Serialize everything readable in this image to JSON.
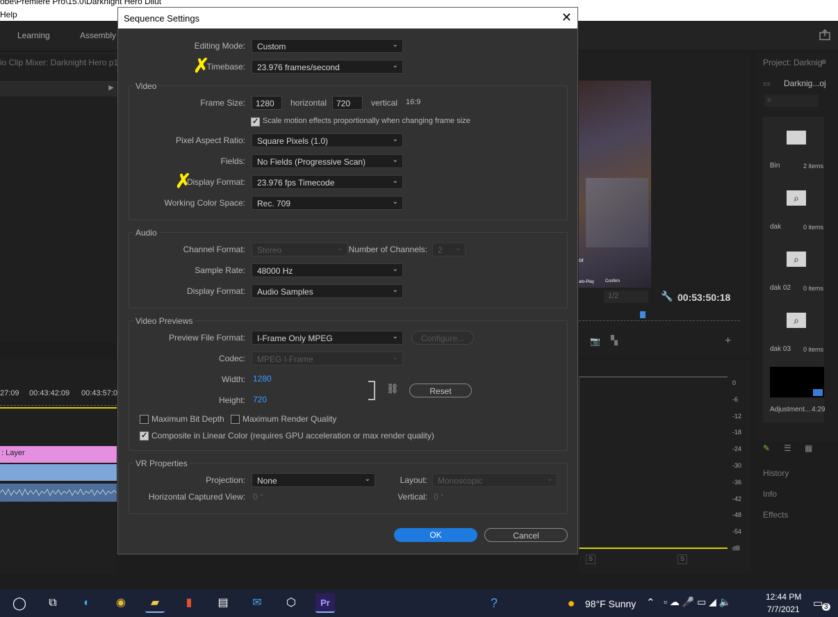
{
  "window": {
    "path_title": "obe\\Premiere Pro\\15.0\\Darknight Hero Dilut",
    "menu_help": "Help"
  },
  "workspace": {
    "tabs": [
      "Learning",
      "Assembly"
    ]
  },
  "left_panel": {
    "mixer_title": "io Clip Mixer: Darknight Hero p1",
    "timecodes": [
      "27:09",
      "00:43:42:09",
      "00:43:57:0"
    ],
    "clip_label": ": Layer"
  },
  "program": {
    "zoom": "1/2",
    "timecode": "00:53:50:18",
    "game_prompt": "Confirm",
    "game_side": "ato-Play",
    "game_or": "or"
  },
  "project": {
    "title": "Project: Darknig",
    "file": "Darknig...oj",
    "items": [
      {
        "name": "Bin",
        "count": "2 items"
      },
      {
        "name": "dak",
        "count": "0 items"
      },
      {
        "name": "dak 02",
        "count": "0 items"
      },
      {
        "name": "dak 03",
        "count": "0 items"
      },
      {
        "name": "Adjustment...",
        "count": "4:29"
      }
    ],
    "panels": [
      "History",
      "Info",
      "Effects"
    ]
  },
  "meter": {
    "labels": [
      "0",
      "-6",
      "-12",
      "-18",
      "-24",
      "-30",
      "-36",
      "-42",
      "-48",
      "-54",
      "dB"
    ],
    "solo": [
      "S",
      "S"
    ]
  },
  "dialog": {
    "title": "Sequence Settings",
    "editing_mode": {
      "label": "Editing Mode:",
      "value": "Custom"
    },
    "timebase": {
      "label": "Timebase:",
      "value": "23.976  frames/second"
    },
    "video": {
      "title": "Video",
      "frame_size_label": "Frame Size:",
      "width": "1280",
      "horizontal": "horizontal",
      "height": "720",
      "vertical": "vertical",
      "ratio": "16:9",
      "scale_label": "Scale motion effects proportionally when changing frame size",
      "par_label": "Pixel Aspect Ratio:",
      "par_value": "Square Pixels (1.0)",
      "fields_label": "Fields:",
      "fields_value": "No Fields (Progressive Scan)",
      "display_label": "Display Format:",
      "display_value": "23.976 fps Timecode",
      "color_label": "Working Color Space:",
      "color_value": "Rec. 709"
    },
    "audio": {
      "title": "Audio",
      "channel_label": "Channel Format:",
      "channel_value": "Stereo",
      "num_label": "Number of Channels:",
      "num_value": "2",
      "rate_label": "Sample Rate:",
      "rate_value": "48000 Hz",
      "display_label": "Display Format:",
      "display_value": "Audio Samples"
    },
    "previews": {
      "title": "Video Previews",
      "format_label": "Preview File Format:",
      "format_value": "I-Frame Only MPEG",
      "configure": "Configure...",
      "codec_label": "Codec:",
      "codec_value": "MPEG I-Frame",
      "width_label": "Width:",
      "width_value": "1280",
      "height_label": "Height:",
      "height_value": "720",
      "reset": "Reset",
      "max_depth": "Maximum Bit Depth",
      "max_quality": "Maximum Render Quality",
      "composite": "Composite in Linear Color (requires GPU acceleration or max render quality)"
    },
    "vr": {
      "title": "VR Properties",
      "projection_label": "Projection:",
      "projection_value": "None",
      "layout_label": "Layout:",
      "layout_value": "Monoscopic",
      "hview_label": "Horizontal Captured View:",
      "hview_value": "0 °",
      "vertical_label": "Vertical:",
      "vertical_value": "0 °"
    },
    "ok": "OK",
    "cancel": "Cancel"
  },
  "taskbar": {
    "weather": "98°F  Sunny",
    "time": "12:44 PM",
    "date": "7/7/2021",
    "notif": "3"
  }
}
